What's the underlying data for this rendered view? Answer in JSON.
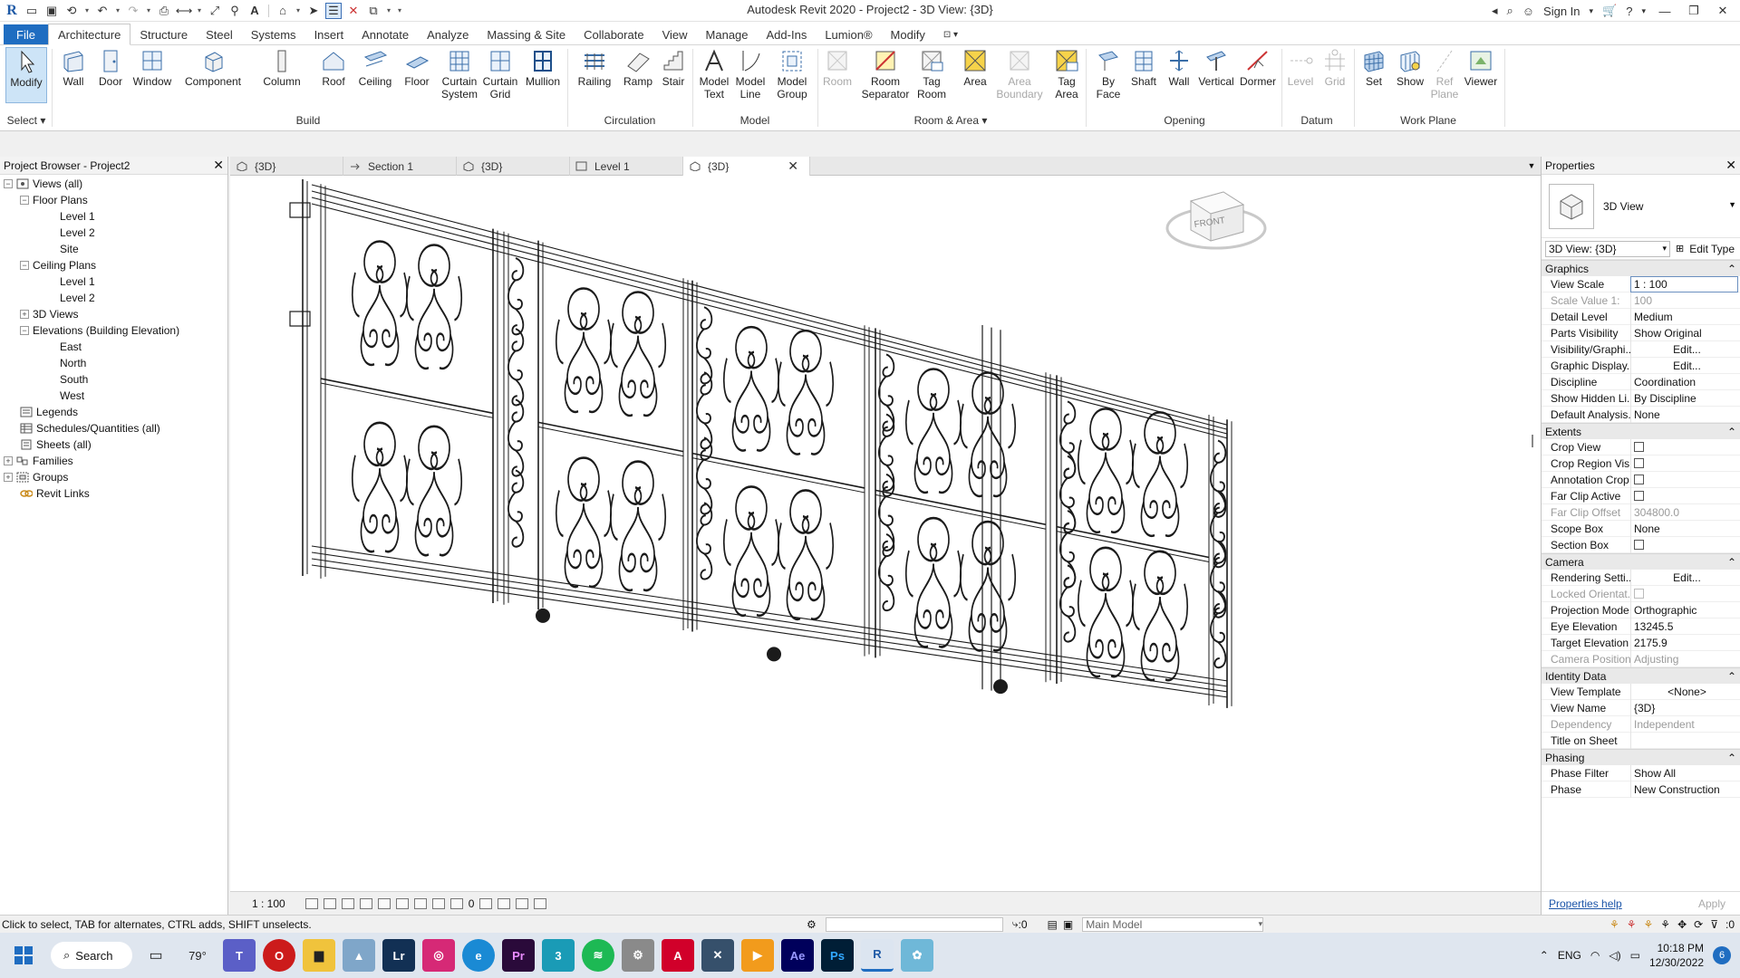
{
  "app": {
    "title": "Autodesk Revit 2020 - Project2 - 3D View: {3D}",
    "sign_in": "Sign In"
  },
  "ribbon_tabs": [
    "File",
    "Architecture",
    "Structure",
    "Steel",
    "Systems",
    "Insert",
    "Annotate",
    "Analyze",
    "Massing & Site",
    "Collaborate",
    "View",
    "Manage",
    "Add-Ins",
    "Lumion®",
    "Modify"
  ],
  "ribbon": {
    "select_label": "Select",
    "buttons": {
      "modify": "Modify",
      "wall": "Wall",
      "door": "Door",
      "window": "Window",
      "component": "Component",
      "column": "Column",
      "roof": "Roof",
      "ceiling": "Ceiling",
      "floor": "Floor",
      "curtain_system_1": "Curtain",
      "curtain_system_2": "System",
      "curtain_grid_1": "Curtain",
      "curtain_grid_2": "Grid",
      "mullion": "Mullion",
      "railing": "Railing",
      "ramp": "Ramp",
      "stair": "Stair",
      "model_text_1": "Model",
      "model_text_2": "Text",
      "model_line_1": "Model",
      "model_line_2": "Line",
      "model_group_1": "Model",
      "model_group_2": "Group",
      "room": "Room",
      "room_sep_1": "Room",
      "room_sep_2": "Separator",
      "tag_room_1": "Tag",
      "tag_room_2": "Room",
      "area": "Area",
      "area_boundary_1": "Area",
      "area_boundary_2": "Boundary",
      "tag_area_1": "Tag",
      "tag_area_2": "Area",
      "by_face_1": "By",
      "by_face_2": "Face",
      "shaft": "Shaft",
      "wall_opening": "Wall",
      "vertical": "Vertical",
      "dormer": "Dormer",
      "level": "Level",
      "grid": "Grid",
      "set": "Set",
      "show": "Show",
      "ref_plane_1": "Ref",
      "ref_plane_2": "Plane",
      "viewer": "Viewer"
    },
    "panels": {
      "build": "Build",
      "circulation": "Circulation",
      "model": "Model",
      "room_area": "Room & Area",
      "opening": "Opening",
      "datum": "Datum",
      "work_plane": "Work Plane"
    }
  },
  "project_browser": {
    "title": "Project Browser - Project2",
    "nodes": [
      {
        "label": "Views (all)",
        "toggle": "−"
      },
      {
        "label": "Floor Plans",
        "toggle": "−"
      },
      {
        "label": "Level 1"
      },
      {
        "label": "Level 2"
      },
      {
        "label": "Site"
      },
      {
        "label": "Ceiling Plans",
        "toggle": "−"
      },
      {
        "label": "Level 1"
      },
      {
        "label": "Level 2"
      },
      {
        "label": "3D Views",
        "toggle": "+"
      },
      {
        "label": "Elevations (Building Elevation)",
        "toggle": "−"
      },
      {
        "label": "East"
      },
      {
        "label": "North"
      },
      {
        "label": "South"
      },
      {
        "label": "West"
      },
      {
        "label": "Legends"
      },
      {
        "label": "Schedules/Quantities (all)"
      },
      {
        "label": "Sheets (all)"
      },
      {
        "label": "Families",
        "toggle": "+"
      },
      {
        "label": "Groups",
        "toggle": "+"
      },
      {
        "label": "Revit Links"
      }
    ]
  },
  "view_tabs": [
    {
      "label": "{3D}"
    },
    {
      "label": "Section 1"
    },
    {
      "label": "{3D}"
    },
    {
      "label": "Level 1"
    },
    {
      "label": "{3D}",
      "active": true
    }
  ],
  "viewcube": {
    "face_label": "FRONT"
  },
  "view_bar": {
    "scale": "1 : 100",
    "zero": "0"
  },
  "properties": {
    "title": "Properties",
    "type_name": "3D View",
    "selector": "3D View: {3D}",
    "edit_type": "Edit Type",
    "groups": [
      {
        "name": "Graphics",
        "rows": [
          {
            "k": "View Scale",
            "v": "1 : 100"
          },
          {
            "k": "Scale Value    1:",
            "v": "100"
          },
          {
            "k": "Detail Level",
            "v": "Medium"
          },
          {
            "k": "Parts Visibility",
            "v": "Show Original"
          },
          {
            "k": "Visibility/Graphi...",
            "v": "Edit..."
          },
          {
            "k": "Graphic Display...",
            "v": "Edit..."
          },
          {
            "k": "Discipline",
            "v": "Coordination"
          },
          {
            "k": "Show Hidden Li...",
            "v": "By Discipline"
          },
          {
            "k": "Default Analysis...",
            "v": "None"
          }
        ]
      },
      {
        "name": "Extents",
        "rows": [
          {
            "k": "Crop View",
            "v": ""
          },
          {
            "k": "Crop Region Vis...",
            "v": ""
          },
          {
            "k": "Annotation Crop",
            "v": ""
          },
          {
            "k": "Far Clip Active",
            "v": ""
          },
          {
            "k": "Far Clip Offset",
            "v": "304800.0"
          },
          {
            "k": "Scope Box",
            "v": "None"
          },
          {
            "k": "Section Box",
            "v": ""
          }
        ]
      },
      {
        "name": "Camera",
        "rows": [
          {
            "k": "Rendering Setti...",
            "v": "Edit..."
          },
          {
            "k": "Locked Orientat...",
            "v": ""
          },
          {
            "k": "Projection Mode",
            "v": "Orthographic"
          },
          {
            "k": "Eye Elevation",
            "v": "13245.5"
          },
          {
            "k": "Target Elevation",
            "v": "2175.9"
          },
          {
            "k": "Camera Position",
            "v": "Adjusting"
          }
        ]
      },
      {
        "name": "Identity Data",
        "rows": [
          {
            "k": "View Template",
            "v": "<None>"
          },
          {
            "k": "View Name",
            "v": "{3D}"
          },
          {
            "k": "Dependency",
            "v": "Independent"
          },
          {
            "k": "Title on Sheet",
            "v": ""
          }
        ]
      },
      {
        "name": "Phasing",
        "rows": [
          {
            "k": "Phase Filter",
            "v": "Show All"
          },
          {
            "k": "Phase",
            "v": "New Construction"
          }
        ]
      }
    ],
    "help_link": "Properties help",
    "apply": "Apply"
  },
  "status_bar": {
    "message": "Click to select, TAB for alternates, CTRL adds, SHIFT unselects.",
    "filter_count": ":0",
    "model": "Main Model",
    "select_count": ":0"
  },
  "taskbar": {
    "search": "Search",
    "weather": "79°",
    "language": "ENG",
    "time": "10:18 PM",
    "date": "12/30/2022",
    "notifications": "6"
  }
}
